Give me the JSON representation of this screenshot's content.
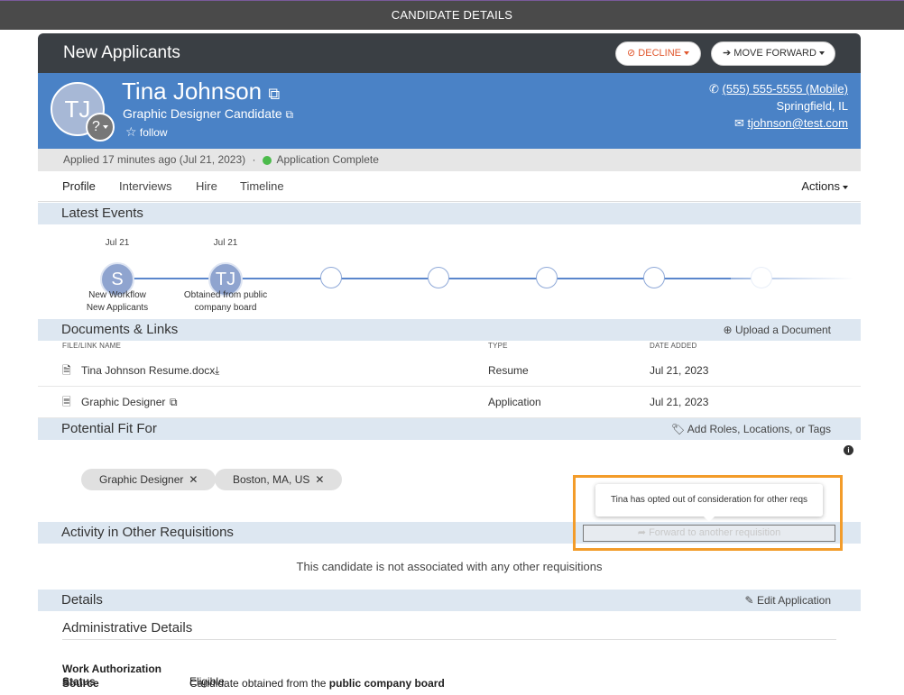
{
  "topbar": {
    "title": "CANDIDATE DETAILS"
  },
  "header": {
    "title": "New Applicants",
    "decline_label": "DECLINE",
    "forward_label": "MOVE FORWARD"
  },
  "candidate": {
    "initials": "TJ",
    "badge": "?",
    "name": "Tina Johnson",
    "role": "Graphic Designer Candidate",
    "follow": "follow",
    "phone": "(555) 555-5555 (Mobile)",
    "location": "Springfield, IL",
    "email": "tjohnson@test.com"
  },
  "status": {
    "applied": "Applied 17 minutes ago (Jul 21, 2023)",
    "separator": "·",
    "state": "Application Complete",
    "state_color": "#4cbb4c"
  },
  "tabs": [
    {
      "label": "Profile"
    },
    {
      "label": "Interviews"
    },
    {
      "label": "Hire"
    },
    {
      "label": "Timeline"
    }
  ],
  "actions_label": "Actions",
  "sections": {
    "latest_events": "Latest Events",
    "documents": "Documents & Links",
    "upload": "Upload a Document",
    "potential_fit": "Potential Fit For",
    "add_roles": "Add Roles, Locations, or Tags",
    "activity": "Activity in Other Requisitions",
    "details": "Details",
    "edit_application": "Edit Application"
  },
  "events": [
    {
      "date": "Jul 21",
      "initial": "S",
      "label_line1": "New Workflow",
      "label_line2": "New Applicants"
    },
    {
      "date": "Jul 21",
      "initial": "TJ",
      "label_line1": "Obtained from public",
      "label_line2": "company board"
    }
  ],
  "documents": {
    "headers": {
      "name": "FILE/LINK NAME",
      "type": "TYPE",
      "date": "DATE ADDED"
    },
    "rows": [
      {
        "name": "Tina Johnson Resume.docx",
        "type": "Resume",
        "date": "Jul 21, 2023"
      },
      {
        "name": "Graphic Designer",
        "type": "Application",
        "date": "Jul 21, 2023"
      }
    ]
  },
  "fit_tags": [
    {
      "label": "Graphic Designer"
    },
    {
      "label": "Boston, MA, US"
    }
  ],
  "tooltip": "Tina has opted out of consideration for other reqs",
  "forward_requisition": "Forward to another requisition",
  "no_requisitions": "This candidate is not associated with any other requisitions",
  "admin": {
    "title": "Administrative Details",
    "work_auth_key": "Work Authorization Status",
    "work_auth_val": "Eligible",
    "source_key": "Source",
    "source_val_prefix": "Candidate obtained from the",
    "source_val_bold": "public company board"
  },
  "colors": {
    "banner": "#4a82c6",
    "header": "#3a3f44",
    "section": "#dde7f1",
    "highlight": "#f39c2a",
    "decline": "#e0552b"
  }
}
